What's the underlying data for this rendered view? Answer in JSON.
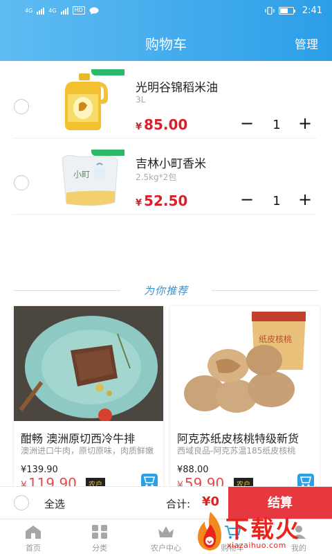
{
  "status_bar": {
    "left_labels": [
      "4G",
      "4G",
      "HD"
    ],
    "time": "2:41"
  },
  "header": {
    "title": "购物车",
    "manage": "管理"
  },
  "cart": {
    "items": [
      {
        "name": "光明谷锦稻米油",
        "spec": "3L",
        "currency": "¥",
        "price": "85.00",
        "quantity": "1"
      },
      {
        "name": "吉林小町香米",
        "spec": "2.5kg*2包",
        "currency": "¥",
        "price": "52.50",
        "quantity": "1"
      }
    ],
    "minus_symbol": "−",
    "plus_symbol": "+"
  },
  "recommend": {
    "title": "为你推荐",
    "products": [
      {
        "title": "酣畅 澳洲原切西冷牛排",
        "desc": "澳洲进口牛肉，原切原味，肉质鲜嫩",
        "original_price": "¥139.90",
        "currency": "¥",
        "farmer_price": "119.90",
        "badge": "农户"
      },
      {
        "title": "阿克苏纸皮核桃特级新货",
        "desc": "西域良品-阿克苏温185纸皮核桃",
        "original_price": "¥88.00",
        "currency": "¥",
        "farmer_price": "59.90",
        "badge": "农户"
      }
    ]
  },
  "checkout": {
    "select_all": "全选",
    "total_label": "合计:",
    "total_value": "¥0",
    "pay": "结算"
  },
  "tabs": [
    {
      "label": "首页",
      "icon": "home-icon"
    },
    {
      "label": "分类",
      "icon": "category-icon"
    },
    {
      "label": "农户中心",
      "icon": "crown-icon"
    },
    {
      "label": "购物车",
      "icon": "cart-icon"
    },
    {
      "label": "我的",
      "icon": "user-icon"
    }
  ],
  "watermark": {
    "text": "下载火",
    "url": "xiazaihuo.com"
  },
  "colors": {
    "header_gradient_start": "#5fbcf2",
    "header_gradient_end": "#2c9ee8",
    "price_red": "#d8202a",
    "pay_button": "#e8383f",
    "recommend_blue": "#3a90cf"
  }
}
